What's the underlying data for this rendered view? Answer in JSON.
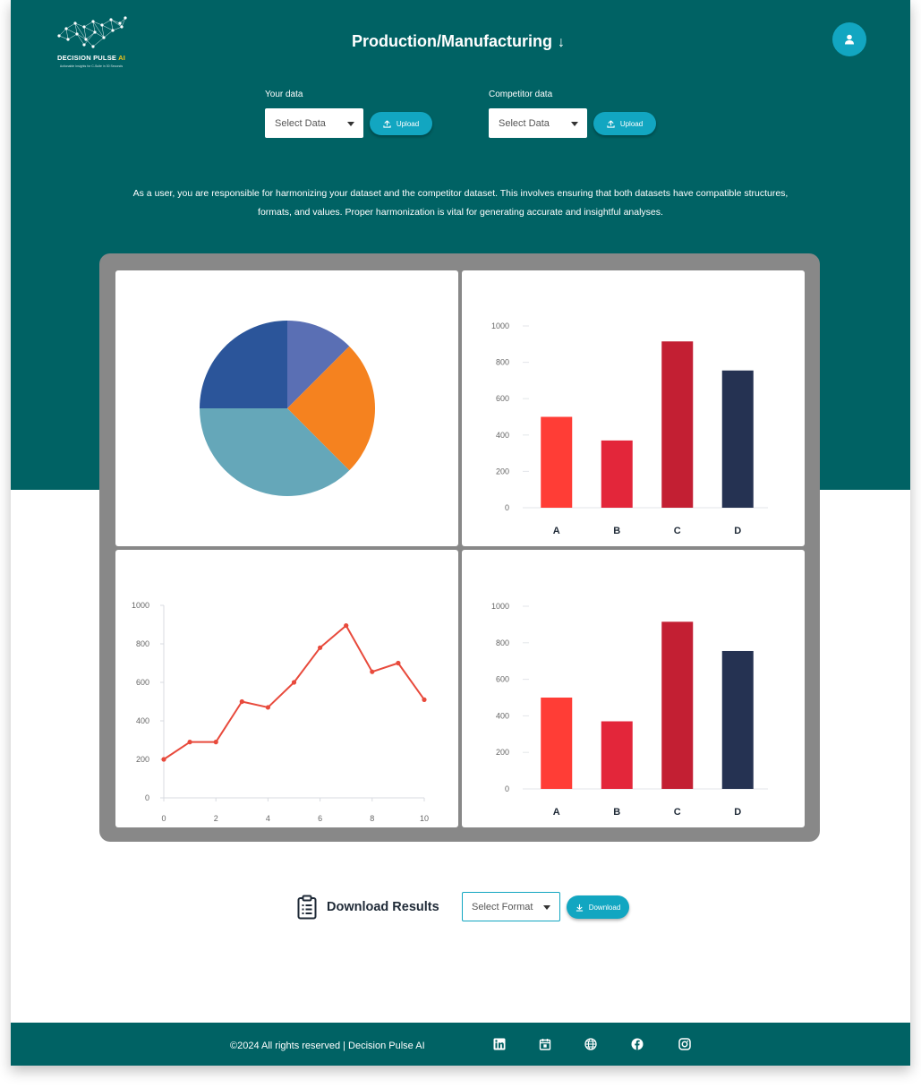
{
  "brand": {
    "name": "DECISION PULSE",
    "name_accent": "AI",
    "tagline": "Actionable Insights for C-Suite in 30 Seconds"
  },
  "header": {
    "title": "Production/Manufacturing",
    "title_icon": "arrow-down-icon",
    "user_icon": "user-avatar-icon"
  },
  "your_data": {
    "label": "Your data",
    "select_value": "Select Data",
    "upload_label": "Upload"
  },
  "competitor_data": {
    "label": "Competitor data",
    "select_value": "Select Data",
    "upload_label": "Upload"
  },
  "description": "As a user, you are responsible for harmonizing your dataset and the competitor dataset. This involves ensuring that both datasets have compatible structures, formats, and values. Proper harmonization is vital for generating accurate and insightful analyses.",
  "download": {
    "title": "Download Results",
    "format_value": "Select Format",
    "button_label": "Download",
    "icon": "clipboard-list-icon"
  },
  "footer": {
    "copyright": "©2024 All rights reserved | Decision Pulse AI",
    "icons": [
      "linkedin-icon",
      "calendar-icon",
      "globe-icon",
      "facebook-icon",
      "instagram-icon"
    ]
  },
  "colors": {
    "teal": "#006264",
    "accent": "#12a6c1",
    "panel": "#888888"
  },
  "chart_data": [
    {
      "type": "pie",
      "slices": [
        {
          "value": 12.5,
          "color": "#5a6fb4"
        },
        {
          "value": 25,
          "color": "#f5821f"
        },
        {
          "value": 37.5,
          "color": "#65a7b9"
        },
        {
          "value": 25,
          "color": "#2b559a"
        }
      ]
    },
    {
      "type": "bar",
      "categories": [
        "A",
        "B",
        "C",
        "D"
      ],
      "values": [
        500,
        370,
        915,
        755
      ],
      "colors": [
        "#ff3d36",
        "#e3263a",
        "#c31f33",
        "#253252"
      ],
      "ylim": [
        0,
        1000
      ],
      "yticks": [
        0,
        200,
        400,
        600,
        800,
        1000
      ]
    },
    {
      "type": "line",
      "x": [
        0,
        1,
        2,
        3,
        4,
        5,
        6,
        7,
        8,
        9,
        10
      ],
      "values": [
        200,
        290,
        290,
        500,
        470,
        600,
        780,
        895,
        655,
        700,
        510
      ],
      "color": "#e84a3c",
      "xlim": [
        0,
        10
      ],
      "ylim": [
        0,
        1000
      ],
      "xticks": [
        0,
        2,
        4,
        6,
        8,
        10
      ],
      "yticks": [
        0,
        200,
        400,
        600,
        800,
        1000
      ]
    },
    {
      "type": "bar",
      "categories": [
        "A",
        "B",
        "C",
        "D"
      ],
      "values": [
        500,
        370,
        915,
        755
      ],
      "colors": [
        "#ff3d36",
        "#e3263a",
        "#c31f33",
        "#253252"
      ],
      "ylim": [
        0,
        1000
      ],
      "yticks": [
        0,
        200,
        400,
        600,
        800,
        1000
      ]
    }
  ]
}
